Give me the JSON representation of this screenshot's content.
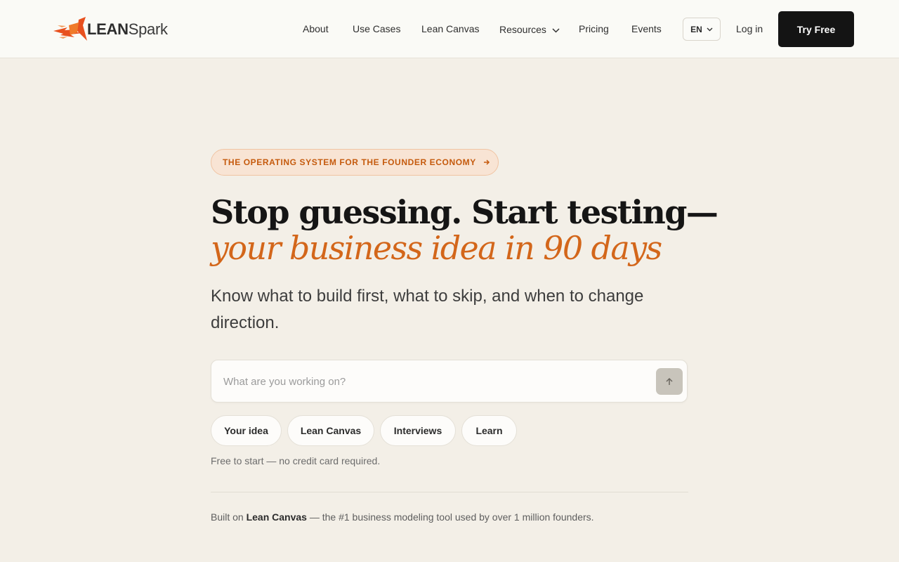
{
  "header": {
    "logo": {
      "brand_bold": "LEAN",
      "brand_light": "Spark"
    },
    "nav": [
      {
        "label": "About"
      },
      {
        "label": "Use Cases"
      },
      {
        "label": "Lean Canvas"
      },
      {
        "label": "Resources"
      },
      {
        "label": "Pricing"
      },
      {
        "label": "Events"
      }
    ],
    "language": "EN",
    "login_label": "Log in",
    "cta_label": "Try Free"
  },
  "hero": {
    "tagline": "THE OPERATING SYSTEM FOR THE FOUNDER ECONOMY",
    "headline_line1": "Stop guessing. Start testing—",
    "headline_line2": "your business idea in 90 days",
    "subheadline": "Know what to build first, what to skip, and when to change direction.",
    "search": {
      "placeholder": "What are you working on?",
      "value": ""
    },
    "chips": [
      "Your idea",
      "Lean Canvas",
      "Interviews",
      "Learn"
    ],
    "note": "Free to start — no credit card required.",
    "built_on": {
      "prefix": "Built on ",
      "product": "Lean Canvas",
      "suffix": " — the #1 business modeling tool used by over 1 million founders."
    }
  },
  "colors": {
    "accent": "#d3661a",
    "background": "#f3efe7",
    "cta_bg": "#141414"
  },
  "icons": {
    "logo": "rocket-spark-logo-icon",
    "dropdown": "chevron-down-icon",
    "tagline_arrow": "arrow-right-icon",
    "send": "arrow-up-icon"
  }
}
